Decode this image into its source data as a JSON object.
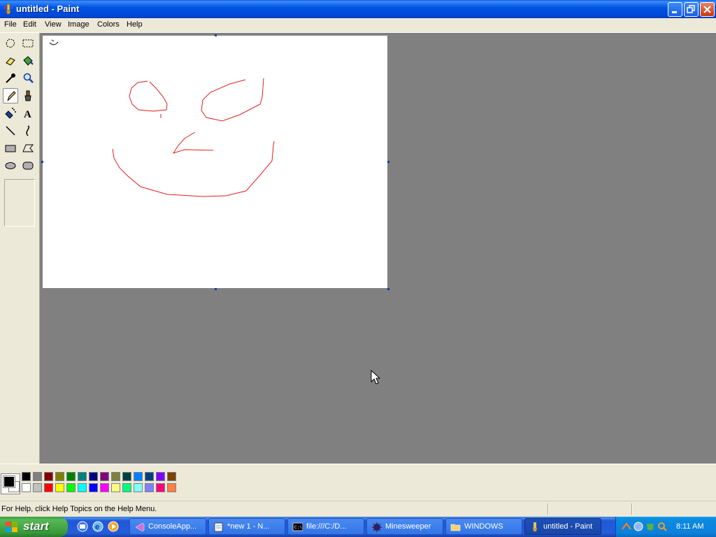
{
  "window": {
    "title": "untitled - Paint",
    "buttons": {
      "minimize": "minimize",
      "maximize": "restore",
      "close": "close"
    }
  },
  "menu": [
    "File",
    "Edit",
    "View",
    "Image",
    "Colors",
    "Help"
  ],
  "tools": [
    "free-form-select",
    "select",
    "eraser",
    "fill-with-color",
    "pick-color",
    "magnifier",
    "pencil",
    "brush",
    "airbrush",
    "text",
    "line",
    "curve",
    "rectangle",
    "polygon",
    "ellipse",
    "rounded-rectangle"
  ],
  "active_tool": "pencil",
  "palette": {
    "foreground": "#000000",
    "background": "#ffffff",
    "top_row": [
      "#000000",
      "#808080",
      "#800000",
      "#808000",
      "#008000",
      "#008080",
      "#000080",
      "#800080",
      "#808040",
      "#004040",
      "#0080FF",
      "#004080",
      "#8000FF",
      "#804000"
    ],
    "bottom_row": [
      "#FFFFFF",
      "#C0C0C0",
      "#FF0000",
      "#FFFF00",
      "#00FF00",
      "#00FFFF",
      "#0000FF",
      "#FF00FF",
      "#FFFF80",
      "#00FF80",
      "#80FFFF",
      "#8080FF",
      "#FF0080",
      "#FF8040"
    ]
  },
  "drawing": {
    "stroke_color": "#E02020"
  },
  "status": {
    "help_text": "For Help, click Help Topics on the Help Menu."
  },
  "taskbar": {
    "start_label": "start",
    "tasks": [
      {
        "label": "ConsoleApp...",
        "icon": "visual-studio-icon"
      },
      {
        "label": "*new 1 - N...",
        "icon": "notepad-icon"
      },
      {
        "label": "file:///C:/D...",
        "icon": "console-icon"
      },
      {
        "label": "Minesweeper",
        "icon": "mine-icon"
      },
      {
        "label": "WINDOWS",
        "icon": "folder-icon"
      },
      {
        "label": "untitled - Paint",
        "icon": "paint-icon",
        "active": true
      }
    ],
    "clock": "8:11 AM"
  }
}
